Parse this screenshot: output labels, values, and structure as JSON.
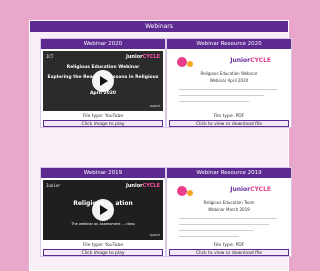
{
  "section_title": "Webinars",
  "brand": {
    "junior": "Junior",
    "cycle": "CYCLE",
    "sub": "for teachers"
  },
  "cards": [
    {
      "title": "Webinar 2020",
      "file_type": "File type: YouTube",
      "action": "Click image to play",
      "thumb": {
        "kind": "video",
        "lines": [
          "Religious Education Webinar",
          "Exploring the Reason ... essons in Religious",
          "April 2020"
        ],
        "logo": "JCT",
        "small": "space"
      }
    },
    {
      "title": "Webinar Resource 2020",
      "file_type": "File type: PDF",
      "action": "Click to view or download file",
      "thumb": {
        "kind": "pdf",
        "lines": [
          "Religious Education Webinar",
          "Webinar April 2020"
        ]
      }
    },
    {
      "title": "Webinar 2019",
      "file_type": "File type: YouTube",
      "action": "Click image to play",
      "thumb": {
        "kind": "video",
        "lines": [
          "Religious ... ation",
          "The webinar on Assessment ... class"
        ],
        "logo": "Junior",
        "small": "space"
      }
    },
    {
      "title": "Webinar Resource 2019",
      "file_type": "File type: PDF",
      "action": "Click to view or download file",
      "thumb": {
        "kind": "pdf",
        "lines": [
          "Religious Education Team",
          "Webinar March 2019"
        ]
      }
    }
  ]
}
